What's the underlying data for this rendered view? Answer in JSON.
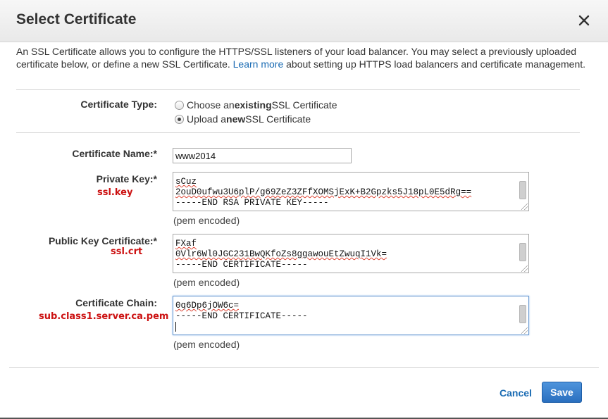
{
  "dialog": {
    "title": "Select Certificate",
    "intro_before_link": "An SSL Certificate allows you to configure the HTTPS/SSL listeners of your load balancer. You may select a previously uploaded certificate below, or define a new SSL Certificate.",
    "intro_link": "Learn more",
    "intro_after_link": "about setting up HTTPS load balancers and certificate management."
  },
  "certificate_type": {
    "label": "Certificate Type:",
    "options": [
      {
        "prefix": "Choose an ",
        "bold": "existing",
        "suffix": " SSL Certificate",
        "selected": false
      },
      {
        "prefix": "Upload a ",
        "bold": "new",
        "suffix": " SSL Certificate",
        "selected": true
      }
    ]
  },
  "certificate_name": {
    "label": "Certificate Name:*",
    "value": "www2014"
  },
  "private_key": {
    "label": "Private Key:*",
    "note": "ssl.key",
    "lines": [
      "sCuz",
      "2ouD0ufwu3U6plP/g69ZeZ3ZFfXOMSjExK+B2Gpzks5J18pL0E5dRg==",
      "-----END RSA PRIVATE KEY-----"
    ],
    "hint": "(pem encoded)"
  },
  "public_key_certificate": {
    "label": "Public Key Certificate:*",
    "note": "ssl.crt",
    "lines": [
      "FXaf",
      "0Vlr6Wl0JGC231BwQKfoZs8ggawouEtZwuqI1Vk=",
      "-----END CERTIFICATE-----"
    ],
    "hint": "(pem encoded)"
  },
  "certificate_chain": {
    "label": "Certificate Chain:",
    "note": "sub.class1.server.ca.pem",
    "lines": [
      "0q6Dp6jOW6c=",
      "-----END CERTIFICATE-----",
      ""
    ],
    "hint": "(pem encoded)"
  },
  "footer": {
    "cancel_label": "Cancel",
    "save_label": "Save"
  },
  "colors": {
    "accent": "#1a6bb3",
    "save_button": "#2a6fbf",
    "annotation": "#cc1111"
  },
  "icons": {
    "close": "close-icon"
  }
}
